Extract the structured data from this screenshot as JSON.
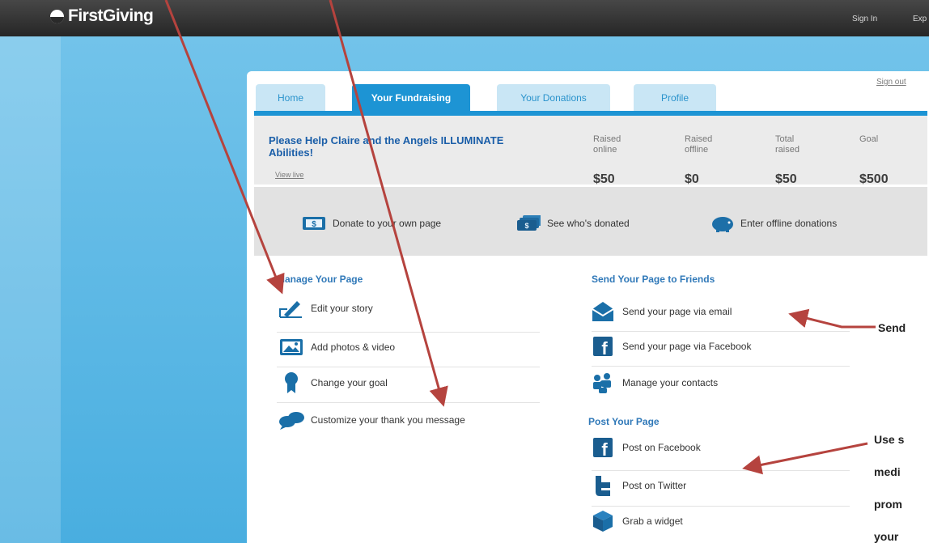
{
  "brand": {
    "name": "FirstGiving"
  },
  "topnav": {
    "sign_in": "Sign In",
    "explore": "Exp"
  },
  "tabs": [
    {
      "label": "Home"
    },
    {
      "label": "Your Fundraising"
    },
    {
      "label": "Your Donations"
    },
    {
      "label": "Profile"
    }
  ],
  "sign_out": "Sign out",
  "campaign": {
    "title": "Please Help Claire and the Angels ILLUMINATE Abilities!",
    "view_live": "View live"
  },
  "stats": [
    {
      "label": "Raised online",
      "value": "$50"
    },
    {
      "label": "Raised offline",
      "value": "$0"
    },
    {
      "label": "Total raised",
      "value": "$50"
    },
    {
      "label": "Goal",
      "value": "$500"
    }
  ],
  "quick_actions": [
    {
      "label": "Donate to your own page",
      "icon": "dollar-bill-icon"
    },
    {
      "label": "See who's donated",
      "icon": "money-stack-icon"
    },
    {
      "label": "Enter offline donations",
      "icon": "piggy-bank-icon"
    }
  ],
  "manage": {
    "title": "Manage Your Page",
    "items": [
      {
        "label": "Edit your story",
        "icon": "pencil-edit-icon"
      },
      {
        "label": "Add photos & video",
        "icon": "picture-icon"
      },
      {
        "label": "Change your goal",
        "icon": "ribbon-award-icon"
      },
      {
        "label": "Customize your thank you message",
        "icon": "speech-bubbles-icon"
      }
    ]
  },
  "send": {
    "title": "Send Your Page to Friends",
    "items": [
      {
        "label": "Send your page via email",
        "icon": "envelope-icon"
      },
      {
        "label": "Send your page via Facebook",
        "icon": "facebook-icon"
      },
      {
        "label": "Manage your contacts",
        "icon": "contacts-icon"
      }
    ]
  },
  "post": {
    "title": "Post Your Page",
    "items": [
      {
        "label": "Post on Facebook",
        "icon": "facebook-icon"
      },
      {
        "label": "Post on Twitter",
        "icon": "twitter-icon"
      },
      {
        "label": "Grab a widget",
        "icon": "widget-box-icon"
      }
    ]
  },
  "callouts": {
    "send": "Send",
    "use_line1": "Use s",
    "use_line2": "medi",
    "use_line3": "prom",
    "use_line4": "your"
  },
  "colors": {
    "accent": "#1d94d4",
    "annotation_arrow": "#b5433e"
  }
}
